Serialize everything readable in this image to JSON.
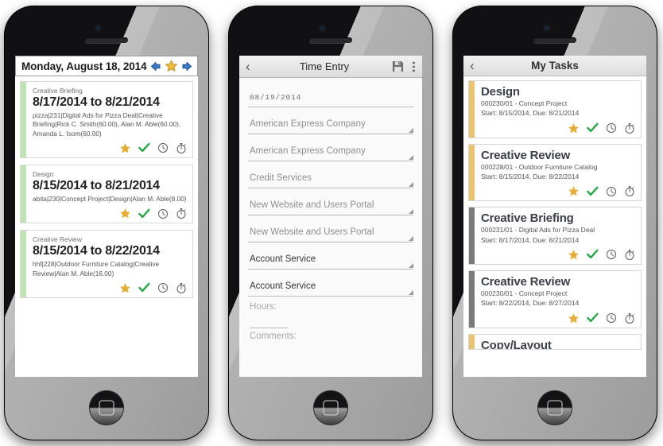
{
  "phone1": {
    "header": {
      "title": "Monday, August 18, 2014",
      "prev_icon": "arrow-left-icon",
      "star_icon": "star-icon",
      "next_icon": "arrow-right-icon"
    },
    "cards": [
      {
        "type": "Creative Briefing",
        "dates": "8/17/2014 to 8/21/2014",
        "meta": "pizza|231|Digital Ads for Pizza Deal|Creative Briefing|Rick C. Smith(60.00), Alan M. Able(60.00), Amanda L. Isom(60.00)",
        "accent": "#bfe3b4"
      },
      {
        "type": "Design",
        "dates": "8/15/2014 to 8/21/2014",
        "meta": "abita|230|Concept Project|Design|Alan M. Able(8.00)",
        "accent": "#bfe3b4"
      },
      {
        "type": "Creative Review",
        "dates": "8/15/2014 to 8/22/2014",
        "meta": "hhf|228|Outdoor Furniture Catalog|Creative Review|Alan M. Able(16.00)",
        "accent": "#bfe3b4"
      }
    ]
  },
  "phone2": {
    "header": {
      "back_icon": "chevron-left-icon",
      "title": "Time Entry",
      "save_icon": "save-floppy-icon",
      "overflow_icon": "more-vertical-icon"
    },
    "fields": [
      {
        "name": "date",
        "value": "08/19/2014",
        "muted": true,
        "dropdown": false
      },
      {
        "name": "client",
        "value": "American Express Company",
        "muted": true,
        "dropdown": true
      },
      {
        "name": "customer",
        "value": "American Express Company",
        "muted": true,
        "dropdown": true
      },
      {
        "name": "division",
        "value": "Credit Services",
        "muted": true,
        "dropdown": true
      },
      {
        "name": "project",
        "value": "New Website and Users Portal",
        "muted": true,
        "dropdown": true
      },
      {
        "name": "job",
        "value": "New Website and Users Portal",
        "muted": true,
        "dropdown": true
      },
      {
        "name": "task",
        "value": "Account Service",
        "muted": false,
        "dropdown": true
      },
      {
        "name": "activity",
        "value": "Account Service",
        "muted": false,
        "dropdown": true
      }
    ],
    "hours_label": "Hours:",
    "hours_value": "",
    "comments_label": "Comments:",
    "comments_value": ""
  },
  "phone3": {
    "header": {
      "back_icon": "chevron-left-icon",
      "title": "My Tasks"
    },
    "cards": [
      {
        "title": "Design",
        "job": "000230/01 - Concept Project",
        "dates": "Start: 8/15/2014, Due: 8/21/2014",
        "accent": "#e7c373"
      },
      {
        "title": "Creative Review",
        "job": "000228/01 - Outdoor Furniture Catalog",
        "dates": "Start: 8/15/2014, Due: 8/22/2014",
        "accent": "#e7c373"
      },
      {
        "title": "Creative Briefing",
        "job": "000231/01 - Digital Ads for Pizza Deal",
        "dates": "Start: 8/17/2014, Due: 8/21/2014",
        "accent": "#7a7a7a"
      },
      {
        "title": "Creative Review",
        "job": "000230/01 - Concept Project",
        "dates": "Start: 8/22/2014, Due: 8/27/2014",
        "accent": "#7a7a7a"
      },
      {
        "title": "Copy/Layout",
        "job": "",
        "dates": "",
        "accent": "#e7c373"
      }
    ]
  },
  "action_icons": {
    "favorite": "star-icon",
    "complete": "check-icon",
    "time": "clock-icon",
    "timer": "stopwatch-icon"
  },
  "colors": {
    "star_gold": "#e8b844",
    "check_green": "#2aa34a",
    "clock_gray": "#555555",
    "accent_green": "#bfe3b4",
    "accent_gold": "#e7c373",
    "accent_gray": "#7a7a7a",
    "nav_blue": "#2f6fc0"
  }
}
